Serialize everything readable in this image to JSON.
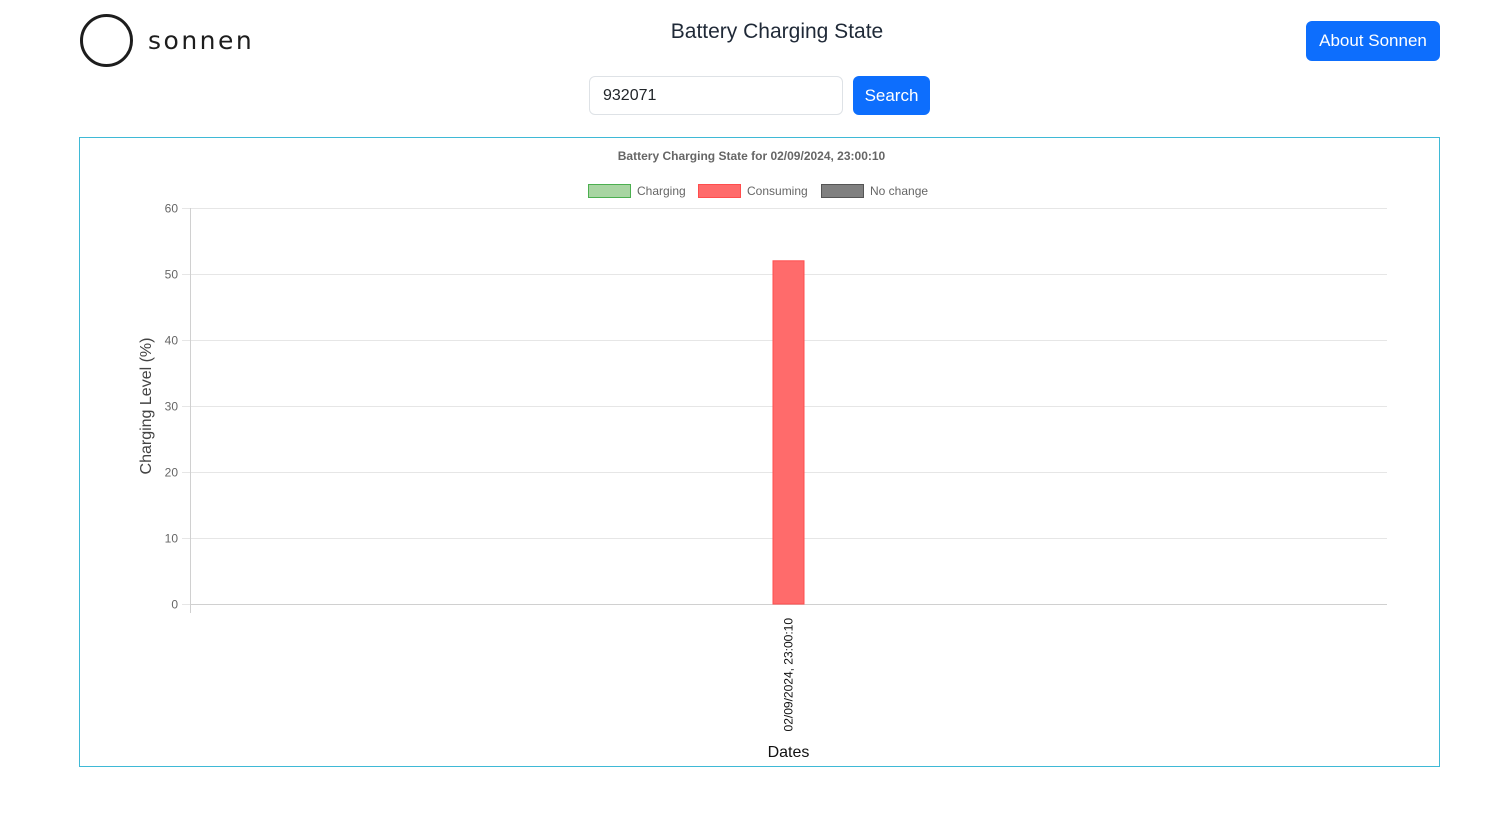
{
  "header": {
    "logo_text": "sonnen",
    "title": "Battery Charging State",
    "about_label": "About Sonnen"
  },
  "search": {
    "value": "932071",
    "button_label": "Search"
  },
  "colors": {
    "primary": "#0d6efd",
    "chart_border": "#3fb9d6",
    "charging_fill": "#a8d5a2",
    "charging_stroke": "#4caf50",
    "consuming_fill": "#ff6b6b",
    "consuming_stroke": "#ff4d4d",
    "nochange_fill": "#808080",
    "nochange_stroke": "#555555"
  },
  "chart_data": {
    "type": "bar",
    "title": "Battery Charging State for 02/09/2024, 23:00:10",
    "xlabel": "Dates",
    "ylabel": "Charging Level (%)",
    "ylim": [
      0,
      60
    ],
    "yticks": [
      0,
      10,
      20,
      30,
      40,
      50,
      60
    ],
    "grid": true,
    "legend_position": "top-center",
    "legend": [
      {
        "label": "Charging",
        "color": "charging"
      },
      {
        "label": "Consuming",
        "color": "consuming"
      },
      {
        "label": "No change",
        "color": "nochange"
      }
    ],
    "categories": [
      "02/09/2024, 23:00:10"
    ],
    "values": [
      52
    ],
    "bar_states": [
      "consuming"
    ]
  }
}
